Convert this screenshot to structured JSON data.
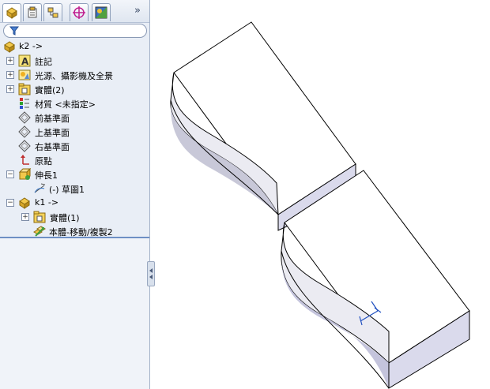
{
  "tabs": [
    {
      "icon": "feature-manager-icon"
    },
    {
      "icon": "property-manager-icon"
    },
    {
      "icon": "configuration-manager-icon"
    },
    {
      "icon": "dimxpert-icon"
    },
    {
      "icon": "display-manager-icon"
    }
  ],
  "tabs_more": "»",
  "tree": {
    "root": "k2 ->",
    "annotations": "註記",
    "lights": "光源、攝影機及全景",
    "solid_bodies": "實體(2)",
    "material": "材質 <未指定>",
    "front_plane": "前基準面",
    "top_plane": "上基準面",
    "right_plane": "右基準面",
    "origin": "原點",
    "extrude": "伸長1",
    "sketch": "(-) 草圖1",
    "k1": "k1 ->",
    "k1_bodies": "實體(1)",
    "move_copy": "本體-移動/複製2"
  },
  "colors": {
    "panel_bg": "#e9eef6",
    "model_top": "#ffffff",
    "model_side_light": "#ddddee",
    "model_front": "#c4c4dc",
    "selection_accent": "#2050c0"
  }
}
